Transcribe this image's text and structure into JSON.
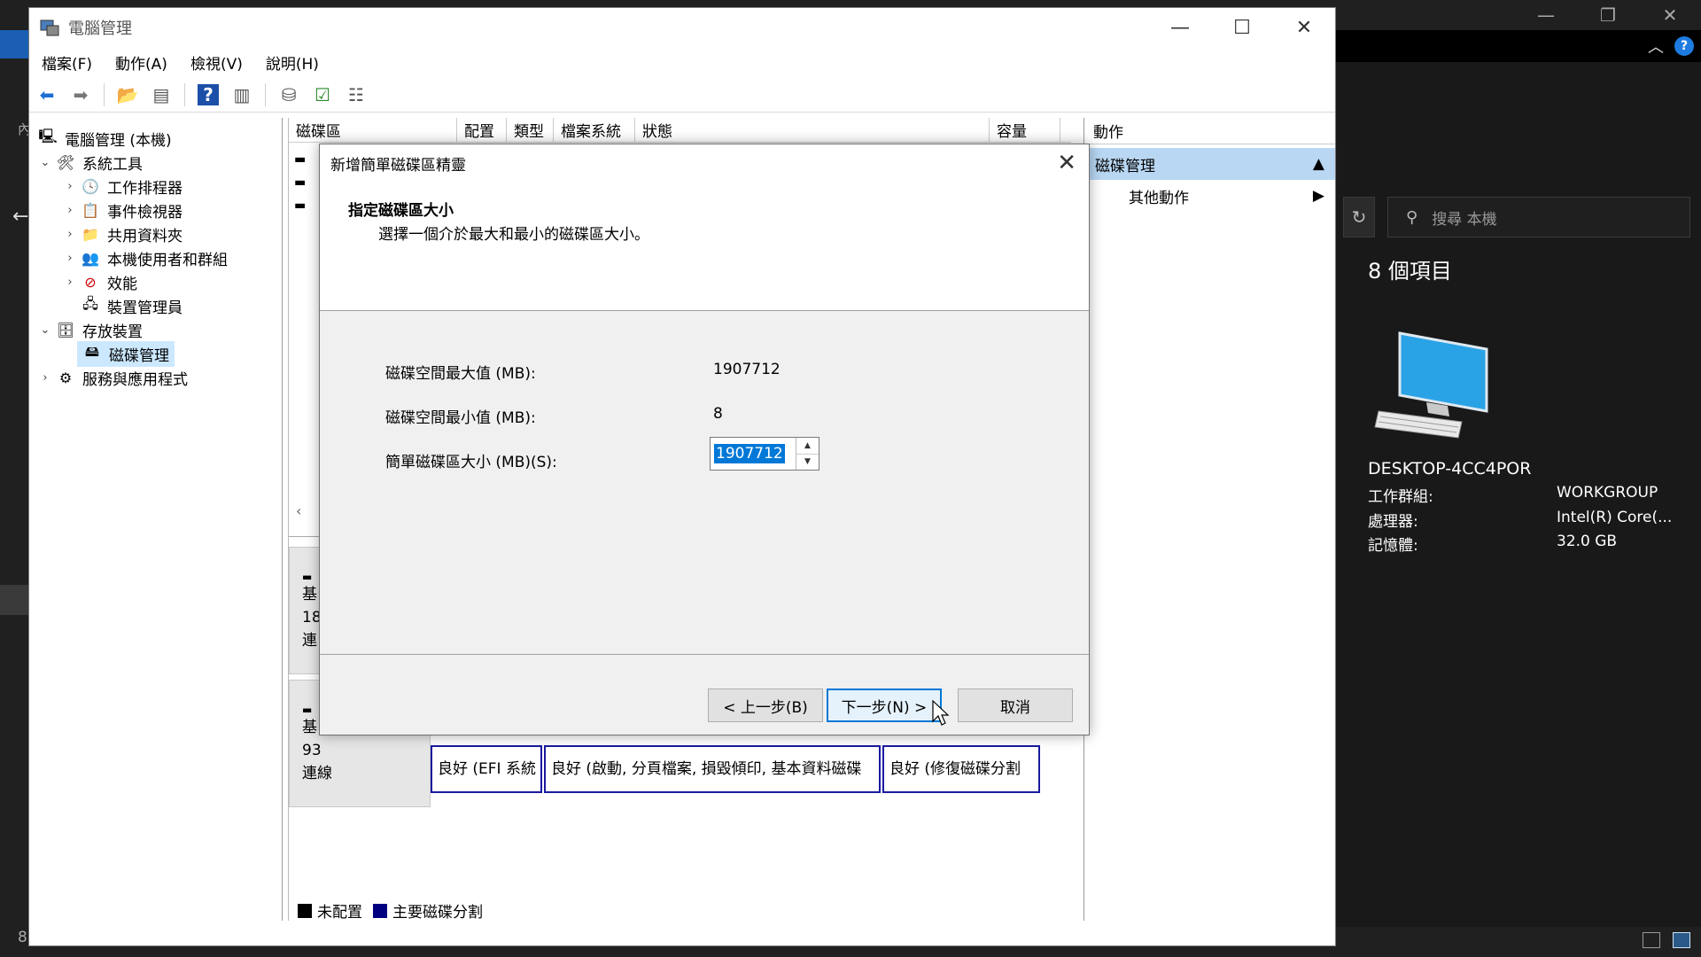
{
  "window": {
    "title": "電腦管理",
    "menu": [
      "檔案(F)",
      "動作(A)",
      "檢視(V)",
      "說明(H)"
    ]
  },
  "tree": {
    "root": "電腦管理 (本機)",
    "system_tools": "系統工具",
    "task_scheduler": "工作排程器",
    "event_viewer": "事件檢視器",
    "shared_folders": "共用資料夾",
    "local_users": "本機使用者和群組",
    "performance": "效能",
    "device_manager": "裝置管理員",
    "storage": "存放裝置",
    "disk_management": "磁碟管理",
    "services_apps": "服務與應用程式"
  },
  "center": {
    "columns": [
      "磁碟區",
      "配置",
      "類型",
      "檔案系統",
      "狀態",
      "容量"
    ],
    "disk1": {
      "line1": "基",
      "line2": "18",
      "line3": "連"
    },
    "disk2": {
      "line1": "基",
      "line2": "93",
      "line3": "連線"
    },
    "volumes": [
      "良好 (EFI 系統",
      "良好 (啟動, 分頁檔案, 損毀傾印, 基本資料磁碟",
      "良好 (修復磁碟分割"
    ],
    "legend": {
      "unallocated": "未配置",
      "primary": "主要磁碟分割"
    }
  },
  "actions": {
    "header": "動作",
    "selected": "磁碟管理",
    "more": "其他動作"
  },
  "dialog": {
    "title": "新增簡單磁碟區精靈",
    "heading": "指定磁碟區大小",
    "subheading": "選擇一個介於最大和最小的磁碟區大小。",
    "max_label": "磁碟空間最大值 (MB):",
    "max_value": "1907712",
    "min_label": "磁碟空間最小值 (MB):",
    "min_value": "8",
    "size_label": "簡單磁碟區大小 (MB)(S):",
    "size_value": "1907712",
    "back_button": "< 上一步(B)",
    "next_button": "下一步(N) >",
    "cancel_button": "取消"
  },
  "explorer": {
    "search_placeholder": "搜尋 本機",
    "item_count": "8 個項目",
    "pc_name": "DESKTOP-4CC4POR",
    "props": [
      {
        "label": "工作群組:",
        "value": "WORKGROUP"
      },
      {
        "label": "處理器:",
        "value": "Intel(R) Core(..."
      },
      {
        "label": "記憶體:",
        "value": "32.0 GB"
      }
    ],
    "left_text": "內",
    "status_left": "8"
  },
  "colors": {
    "accent": "#0078d7",
    "unallocated": "#000000",
    "primary_partition": "#000080",
    "selection": "#cce8ff"
  }
}
